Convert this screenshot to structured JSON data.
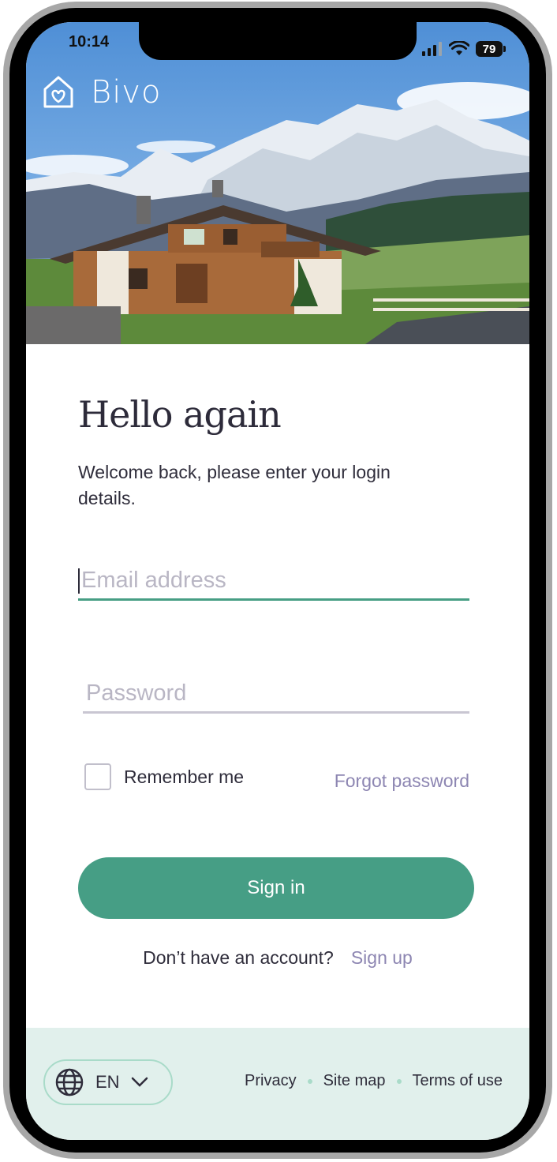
{
  "status_bar": {
    "time": "10:14",
    "battery": "79"
  },
  "brand": {
    "name": "Bivo"
  },
  "login": {
    "title": "Hello again",
    "subtitle": "Welcome back, please enter your login details.",
    "email_placeholder": "Email address",
    "password_placeholder": "Password",
    "remember_label": "Remember me",
    "forgot_label": "Forgot password",
    "signin_label": "Sign in",
    "no_account_text": "Don’t have an account?",
    "signup_label": "Sign up"
  },
  "footer": {
    "language": "EN",
    "links": [
      "Privacy",
      "Site map",
      "Terms of use"
    ]
  },
  "colors": {
    "accent": "#469e85",
    "link": "#8d86b2",
    "footer_bg": "#e1f0ec"
  }
}
